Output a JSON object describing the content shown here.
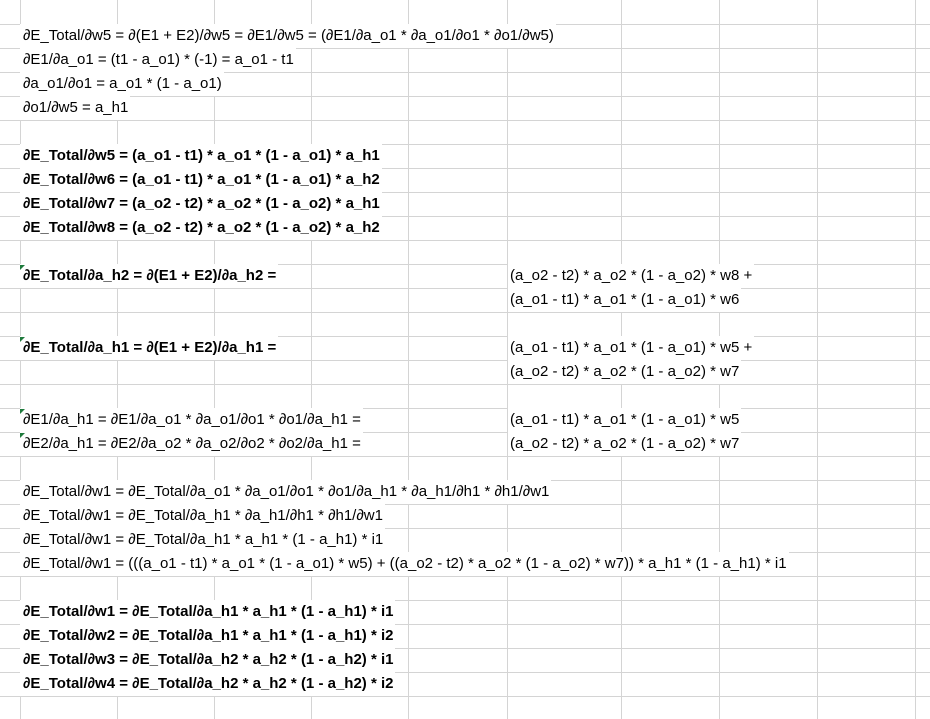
{
  "colors": {
    "gridline": "#d4d4d4",
    "comment_indicator": "#1e7a3c",
    "text": "#000000"
  },
  "rows": [
    {
      "a": "∂E_Total/∂w5 = ∂(E1 + E2)/∂w5 = ∂E1/∂w5 = (∂E1/∂a_o1 * ∂a_o1/∂o1 * ∂o1/∂w5)",
      "f": "",
      "bold": false,
      "flag": false
    },
    {
      "a": "∂E1/∂a_o1 = (t1 - a_o1) * (-1) = a_o1 - t1",
      "f": "",
      "bold": false,
      "flag": false
    },
    {
      "a": "∂a_o1/∂o1 = a_o1 * (1 - a_o1)",
      "f": "",
      "bold": false,
      "flag": false
    },
    {
      "a": "∂o1/∂w5 = a_h1",
      "f": "",
      "bold": false,
      "flag": false
    },
    {
      "a": "",
      "f": "",
      "bold": false,
      "flag": false
    },
    {
      "a": "∂E_Total/∂w5 = (a_o1 - t1) * a_o1 * (1 - a_o1) * a_h1",
      "f": "",
      "bold": true,
      "flag": false
    },
    {
      "a": "∂E_Total/∂w6 = (a_o1 - t1) * a_o1 * (1 - a_o1) * a_h2",
      "f": "",
      "bold": true,
      "flag": false
    },
    {
      "a": "∂E_Total/∂w7 = (a_o2 - t2) * a_o2 * (1 - a_o2) * a_h1",
      "f": "",
      "bold": true,
      "flag": false
    },
    {
      "a": "∂E_Total/∂w8 = (a_o2 - t2) * a_o2 * (1 - a_o2) * a_h2",
      "f": "",
      "bold": true,
      "flag": false
    },
    {
      "a": "",
      "f": "",
      "bold": false,
      "flag": false
    },
    {
      "a": "∂E_Total/∂a_h2 = ∂(E1 + E2)/∂a_h2 =",
      "f": "(a_o2 - t2) * a_o2 * (1 - a_o2) * w8 +",
      "bold": true,
      "flag": true
    },
    {
      "a": "",
      "f": "(a_o1 - t1) * a_o1 * (1 - a_o1) * w6",
      "bold": false,
      "flag": false
    },
    {
      "a": "",
      "f": "",
      "bold": false,
      "flag": false
    },
    {
      "a": "∂E_Total/∂a_h1 = ∂(E1 + E2)/∂a_h1 =",
      "f": "(a_o1 - t1) * a_o1 * (1 - a_o1) * w5 +",
      "bold": true,
      "flag": true
    },
    {
      "a": "",
      "f": "(a_o2 - t2) * a_o2 * (1 - a_o2) * w7",
      "bold": false,
      "flag": false
    },
    {
      "a": "",
      "f": "",
      "bold": false,
      "flag": false
    },
    {
      "a": "∂E1/∂a_h1 = ∂E1/∂a_o1 * ∂a_o1/∂o1 * ∂o1/∂a_h1 =",
      "f": "(a_o1 - t1) * a_o1 * (1 - a_o1) * w5",
      "bold": false,
      "flag": true
    },
    {
      "a": "∂E2/∂a_h1 = ∂E2/∂a_o2 * ∂a_o2/∂o2 * ∂o2/∂a_h1 =",
      "f": "(a_o2 - t2) * a_o2 * (1 - a_o2) * w7",
      "bold": false,
      "flag": true
    },
    {
      "a": "",
      "f": "",
      "bold": false,
      "flag": false
    },
    {
      "a": "∂E_Total/∂w1 = ∂E_Total/∂a_o1 * ∂a_o1/∂o1 * ∂o1/∂a_h1 * ∂a_h1/∂h1 * ∂h1/∂w1",
      "f": "",
      "bold": false,
      "flag": false
    },
    {
      "a": "∂E_Total/∂w1 = ∂E_Total/∂a_h1 * ∂a_h1/∂h1 * ∂h1/∂w1",
      "f": "",
      "bold": false,
      "flag": false
    },
    {
      "a": "∂E_Total/∂w1 = ∂E_Total/∂a_h1 * a_h1 * (1 - a_h1) * i1",
      "f": "",
      "bold": false,
      "flag": false
    },
    {
      "a": "∂E_Total/∂w1 = (((a_o1 - t1) * a_o1 * (1 - a_o1) * w5) + ((a_o2 - t2) * a_o2 * (1 - a_o2) * w7)) * a_h1 * (1 - a_h1) * i1",
      "f": "",
      "bold": false,
      "flag": false
    },
    {
      "a": "",
      "f": "",
      "bold": false,
      "flag": false
    },
    {
      "a": "∂E_Total/∂w1 = ∂E_Total/∂a_h1 * a_h1 * (1 - a_h1) * i1",
      "f": "",
      "bold": true,
      "flag": false
    },
    {
      "a": "∂E_Total/∂w2 = ∂E_Total/∂a_h1 * a_h1 * (1 - a_h1) * i2",
      "f": "",
      "bold": true,
      "flag": false
    },
    {
      "a": "∂E_Total/∂w3 = ∂E_Total/∂a_h2 * a_h2 * (1 - a_h2) * i1",
      "f": "",
      "bold": true,
      "flag": false
    },
    {
      "a": "∂E_Total/∂w4 = ∂E_Total/∂a_h2 * a_h2 * (1 - a_h2) * i2",
      "f": "",
      "bold": true,
      "flag": false
    }
  ]
}
